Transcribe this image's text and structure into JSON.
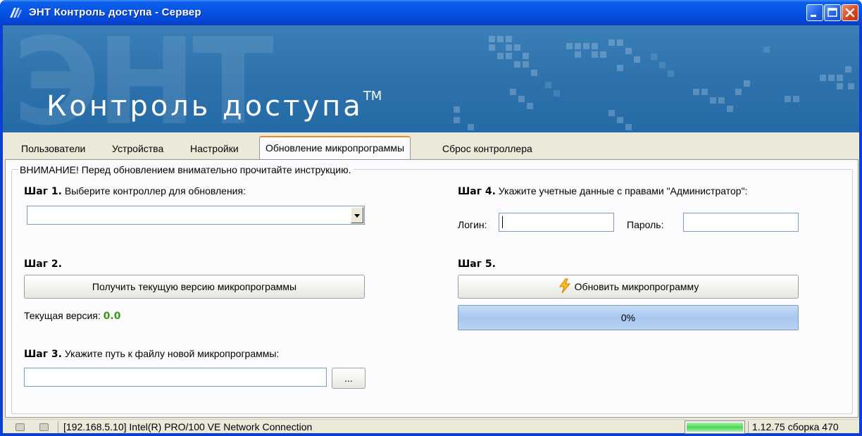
{
  "window": {
    "title": "ЭНТ Контроль доступа - Сервер"
  },
  "banner": {
    "watermark": "ЭНТ",
    "brand": "Контроль доступа",
    "trademark": "TM"
  },
  "tabs": [
    {
      "label": "Пользователи"
    },
    {
      "label": "Устройства"
    },
    {
      "label": "Настройки"
    },
    {
      "label": "Обновление микропрограммы"
    },
    {
      "label": "Сброс контроллера"
    }
  ],
  "active_tab": "Обновление микропрограммы",
  "firmware": {
    "warning": "ВНИМАНИЕ! Перед обновлением внимательно прочитайте инструкцию.",
    "step1": {
      "label": "Шаг 1.",
      "text": "Выберите контроллер для обновления:",
      "selected_controller": ""
    },
    "step2": {
      "label": "Шаг 2.",
      "button": "Получить текущую версию микропрограммы",
      "current_version_label": "Текущая версия:",
      "current_version": "0.0"
    },
    "step3": {
      "label": "Шаг 3.",
      "text": "Укажите путь к файлу новой микропрограммы:",
      "path": "",
      "browse_button": "..."
    },
    "step4": {
      "label": "Шаг 4.",
      "text": "Укажите учетные данные с правами \"Администратор\":",
      "login_label": "Логин:",
      "login_value": "",
      "password_label": "Пароль:",
      "password_value": ""
    },
    "step5": {
      "label": "Шаг 5.",
      "button": "Обновить микропрограмму",
      "progress_text": "0%",
      "progress_value": 0
    }
  },
  "statusbar": {
    "connection": "[192.168.5.10] Intel(R) PRO/100 VE Network Connection",
    "version": "1.12.75 сборка 470",
    "activity_level": 1.0
  },
  "colors": {
    "titlebar": "#0652e3",
    "banner": "#2f73ad",
    "version_value": "#3a9a1a",
    "active_tab_highlight": "#e68b2c",
    "status_progress": "#4fd65a"
  },
  "icons": {
    "app": "ent-logo-icon",
    "update_button": "lightning-icon",
    "combo": "dropdown-arrow-icon"
  }
}
